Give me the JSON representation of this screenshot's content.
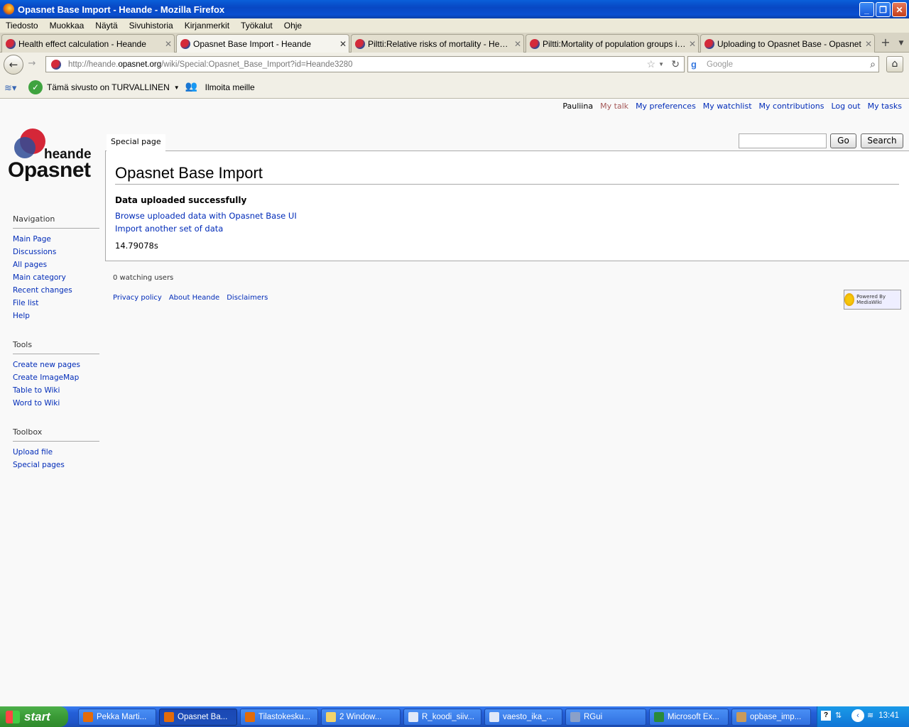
{
  "window": {
    "title": "Opasnet Base Import - Heande - Mozilla Firefox"
  },
  "menu": [
    "Tiedosto",
    "Muokkaa",
    "Näytä",
    "Sivuhistoria",
    "Kirjanmerkit",
    "Työkalut",
    "Ohje"
  ],
  "tabs": [
    {
      "label": "Health effect calculation - Heande"
    },
    {
      "label": "Opasnet Base Import - Heande"
    },
    {
      "label": "Piltti:Relative risks of mortality - Heande"
    },
    {
      "label": "Piltti:Mortality of population groups in Fi..."
    },
    {
      "label": "Uploading to Opasnet Base - Opasnet"
    }
  ],
  "url": {
    "prefix": "http://heande.",
    "domain": "opasnet.org",
    "path": "/wiki/Special:Opasnet_Base_Import?id=Heande3280"
  },
  "search": {
    "placeholder": "Google"
  },
  "addon": {
    "safe_label": "Tämä sivusto on TURVALLINEN",
    "report_label": "Ilmoita meille"
  },
  "personal": {
    "user": "Pauliina",
    "talk": "My talk",
    "preferences": "My preferences",
    "watchlist": "My watchlist",
    "contributions": "My contributions",
    "logout": "Log out",
    "tasks": "My tasks"
  },
  "logo": {
    "top": "heande",
    "bottom": "Opasnet"
  },
  "navigation": {
    "title": "Navigation",
    "items": [
      "Main Page",
      "Discussions",
      "All pages",
      "Main category",
      "Recent changes",
      "File list",
      "Help"
    ]
  },
  "tools": {
    "title": "Tools",
    "items": [
      "Create new pages",
      "Create ImageMap",
      "Table to Wiki",
      "Word to Wiki"
    ]
  },
  "toolbox": {
    "title": "Toolbox",
    "items": [
      "Upload file",
      "Special pages"
    ]
  },
  "page": {
    "tab": "Special page",
    "go": "Go",
    "search": "Search",
    "title": "Opasnet Base Import",
    "success": "Data uploaded successfully",
    "browse_link": "Browse uploaded data with Opasnet Base UI",
    "import_link": "Import another set of data",
    "time": "14.79078s"
  },
  "footer": {
    "watching": "0 watching users",
    "links": [
      "Privacy policy",
      "About Heande",
      "Disclaimers"
    ],
    "powered": "Powered By MediaWiki"
  },
  "taskbar": {
    "start": "start",
    "items": [
      "Pekka Marti...",
      "Opasnet Ba...",
      "Tilastokesku...",
      "2 Window...",
      "R_koodi_siiv...",
      "vaesto_ika_...",
      "RGui",
      "Microsoft Ex...",
      "opbase_imp..."
    ],
    "clock": "13:41"
  }
}
